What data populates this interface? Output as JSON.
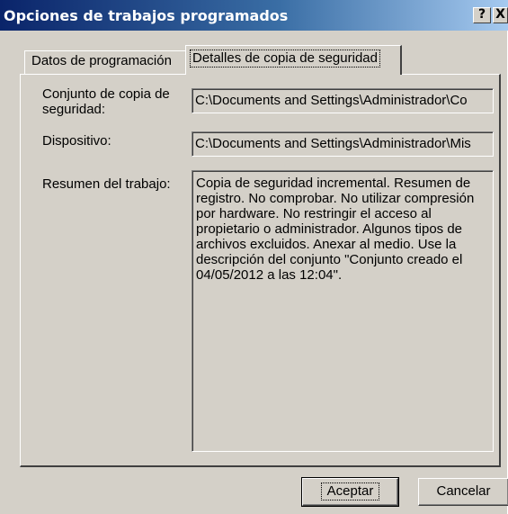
{
  "window": {
    "title": "Opciones de trabajos programados",
    "help_label": "?",
    "close_label": "X"
  },
  "tabs": [
    {
      "label": "Datos de programación",
      "active": false
    },
    {
      "label": "Detalles de copia de seguridad",
      "active": true
    }
  ],
  "details": {
    "backup_set_label": "Conjunto de copia de seguridad:",
    "backup_set_value": "C:\\Documents and Settings\\Administrador\\Co",
    "device_label": "Dispositivo:",
    "device_value": "C:\\Documents and Settings\\Administrador\\Mis",
    "summary_label": "Resumen del trabajo:",
    "summary_value": "Copia de seguridad incremental.  Resumen de registro.  No comprobar.  No utilizar compresión por hardware.  No restringir el acceso al propietario o administrador.  Algunos tipos de archivos excluidos.  Anexar al medio.  Use la descripción del conjunto \"Conjunto creado el 04/05/2012 a las 12:04\"."
  },
  "buttons": {
    "ok_label": "Aceptar",
    "cancel_label": "Cancelar"
  },
  "colors": {
    "titlebar_start": "#0a246a",
    "titlebar_end": "#a6caf0",
    "face": "#d4d0c8"
  }
}
